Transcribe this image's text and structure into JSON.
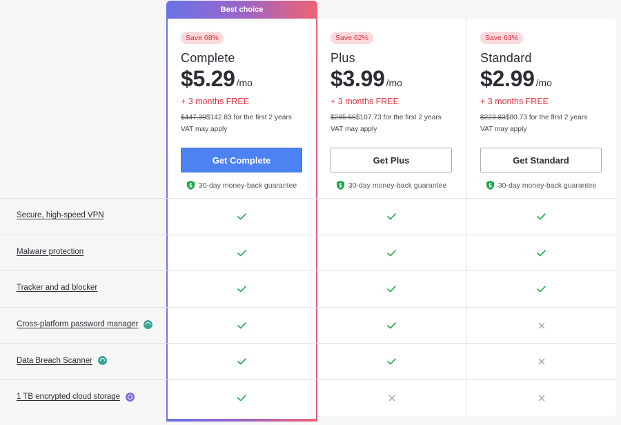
{
  "best_choice_label": "Best choice",
  "plans": [
    {
      "save": "Save 68%",
      "name": "Complete",
      "price": "$5.29",
      "per": "/mo",
      "bonus": "+ 3 months FREE",
      "old_price": "$447.39",
      "new_price": "$142.83 for the first 2 years",
      "vat": "VAT may apply",
      "cta": "Get Complete",
      "guarantee": "30-day money-back guarantee"
    },
    {
      "save": "Save 62%",
      "name": "Plus",
      "price": "$3.99",
      "per": "/mo",
      "bonus": "+ 3 months FREE",
      "old_price": "$285.66",
      "new_price": "$107.73 for the first 2 years",
      "vat": "VAT may apply",
      "cta": "Get Plus",
      "guarantee": "30-day money-back guarantee"
    },
    {
      "save": "Save 63%",
      "name": "Standard",
      "price": "$2.99",
      "per": "/mo",
      "bonus": "+ 3 months FREE",
      "old_price": "$223.83",
      "new_price": "$80.73 for the first 2 years",
      "vat": "VAT may apply",
      "cta": "Get Standard",
      "guarantee": "30-day money-back guarantee"
    }
  ],
  "features": [
    {
      "label": "Secure, high-speed VPN",
      "icon": "",
      "included": [
        true,
        true,
        true
      ]
    },
    {
      "label": "Malware protection",
      "icon": "",
      "included": [
        true,
        true,
        true
      ]
    },
    {
      "label": "Tracker and ad blocker",
      "icon": "",
      "included": [
        true,
        true,
        true
      ]
    },
    {
      "label": "Cross-platform password manager",
      "icon": "password-manager-icon",
      "included": [
        true,
        true,
        false
      ]
    },
    {
      "label": "Data Breach Scanner",
      "icon": "breach-scanner-icon",
      "included": [
        true,
        true,
        false
      ]
    },
    {
      "label": "1 TB encrypted cloud storage",
      "icon": "cloud-storage-icon",
      "included": [
        true,
        false,
        false
      ]
    }
  ],
  "colors": {
    "accent_blue": "#4c82f2",
    "save_red": "#e0303f",
    "check_green": "#1aa64a",
    "cross_gray": "#a4a6ad",
    "gradient_start": "#6a72e6",
    "gradient_end": "#f06272"
  }
}
